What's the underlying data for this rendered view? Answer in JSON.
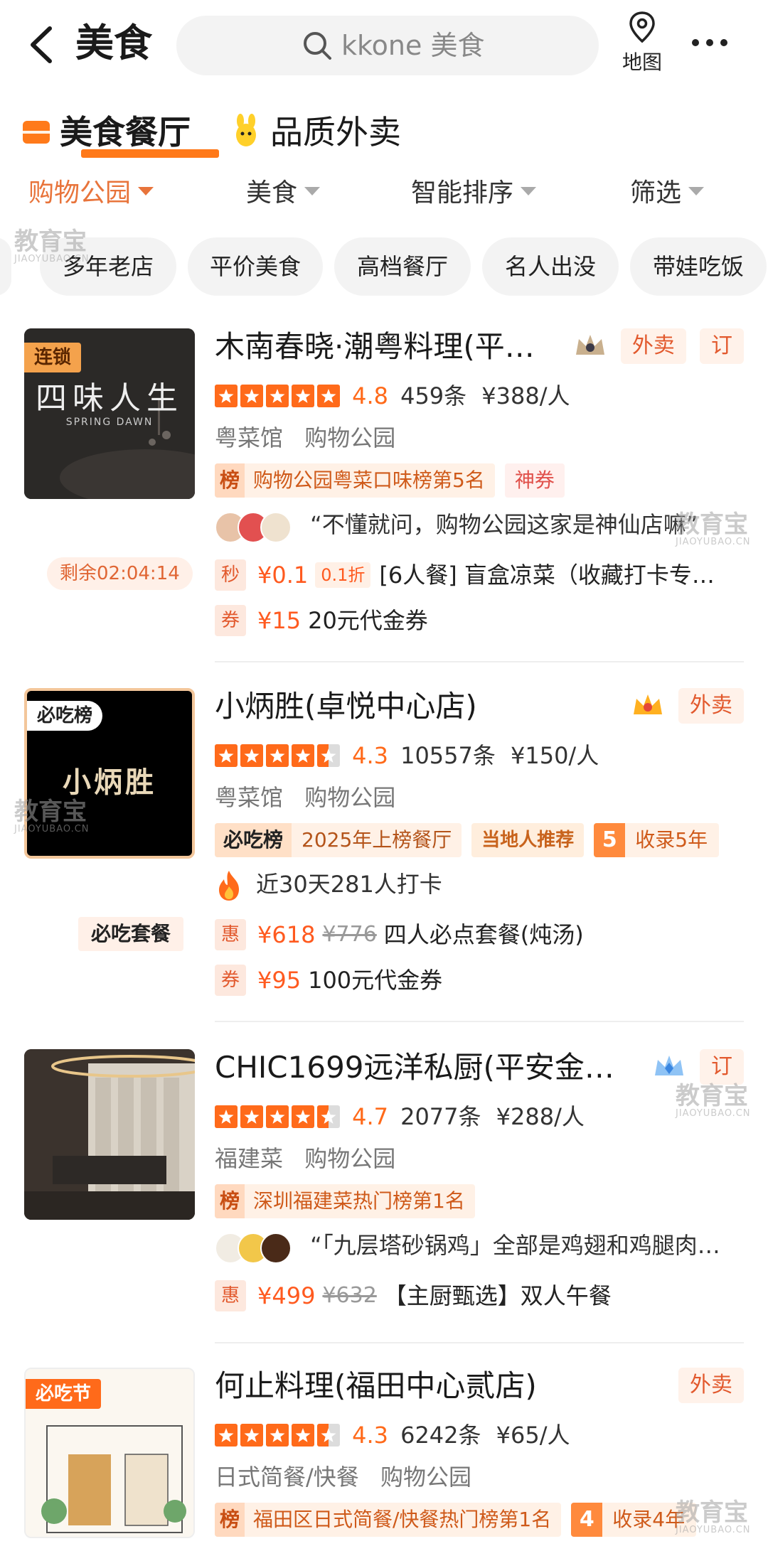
{
  "header": {
    "title": "美食",
    "search_placeholder": "kkone 美食",
    "map_label": "地图"
  },
  "category_tabs": [
    {
      "label": "美食餐厅",
      "active": true
    },
    {
      "label": "品质外卖",
      "active": false
    }
  ],
  "filters": [
    {
      "label": "购物公园",
      "active": true
    },
    {
      "label": "美食",
      "active": false
    },
    {
      "label": "智能排序",
      "active": false
    },
    {
      "label": "筛选",
      "active": false
    }
  ],
  "chips": [
    "多年老店",
    "平价美食",
    "高档餐厅",
    "名人出没",
    "带娃吃饭"
  ],
  "watermark": {
    "text": "教育宝",
    "sub": "JIAOYUBAO.CN"
  },
  "colors": {
    "accent": "#ff6a1a",
    "price": "#ff5a1f",
    "chip_bg": "#f3f3f3"
  },
  "restaurants": [
    {
      "name": "木南春晓·潮粤料理(平…",
      "thumb_label": "连锁",
      "thumb_title": "四味人生",
      "thumb_sub": "SPRING DAWN",
      "rating": 4.8,
      "score": "4.8",
      "reviews": "459条",
      "per_person": "¥388/人",
      "categories": [
        "粤菜馆",
        "购物公园"
      ],
      "tags": [
        "外卖",
        "订"
      ],
      "rank_icon": "榜",
      "rank_text": "购物公园粤菜口味榜第5名",
      "extra_tag": "神券",
      "review": "“不懂就问，购物公园这家是神仙店嘛”",
      "countdown": "剩余02:04:14",
      "deals": [
        {
          "icon": "秒",
          "price": "¥0.1",
          "discount": "0.1折",
          "text": "[6人餐] 盲盒凉菜（收藏打卡专…"
        },
        {
          "icon": "券",
          "price": "¥15",
          "text": "20元代金券"
        }
      ]
    },
    {
      "name": "小炳胜(卓悦中心店)",
      "thumb_label": "必吃榜",
      "thumb_title": "小炳胜",
      "rating": 4.3,
      "score": "4.3",
      "reviews": "10557条",
      "per_person": "¥150/人",
      "categories": [
        "粤菜馆",
        "购物公园"
      ],
      "tags": [
        "外卖"
      ],
      "bichi_label": "必吃榜",
      "bichi_text": "2025年上榜餐厅",
      "local_tag": "当地人推荐",
      "collect_num": "5",
      "collect_text": "收录5年",
      "checkin": "近30天281人打卡",
      "combo_tag": "必吃套餐",
      "deals": [
        {
          "icon": "惠",
          "price": "¥618",
          "original": "¥776",
          "text": "四人必点套餐(炖汤)"
        },
        {
          "icon": "券",
          "price": "¥95",
          "text": "100元代金券"
        }
      ]
    },
    {
      "name": "CHIC1699远洋私厨(平安金…",
      "rating": 4.7,
      "score": "4.7",
      "reviews": "2077条",
      "per_person": "¥288/人",
      "categories": [
        "福建菜",
        "购物公园"
      ],
      "tags": [
        "订"
      ],
      "rank_icon": "榜",
      "rank_text": "深圳福建菜热门榜第1名",
      "review": "“「九层塔砂锅鸡」全部是鸡翅和鸡腿肉…",
      "deals": [
        {
          "icon": "惠",
          "price": "¥499",
          "original": "¥632",
          "text": "【主厨甄选】双人午餐"
        }
      ]
    },
    {
      "name": "何止料理(福田中心贰店)",
      "thumb_label": "必吃节",
      "rating": 4.3,
      "score": "4.3",
      "reviews": "6242条",
      "per_person": "¥65/人",
      "categories": [
        "日式简餐/快餐",
        "购物公园"
      ],
      "tags": [
        "外卖"
      ],
      "rank_icon": "榜",
      "rank_text": "福田区日式简餐/快餐热门榜第1名",
      "collect_num": "4",
      "collect_text": "收录4年"
    }
  ]
}
